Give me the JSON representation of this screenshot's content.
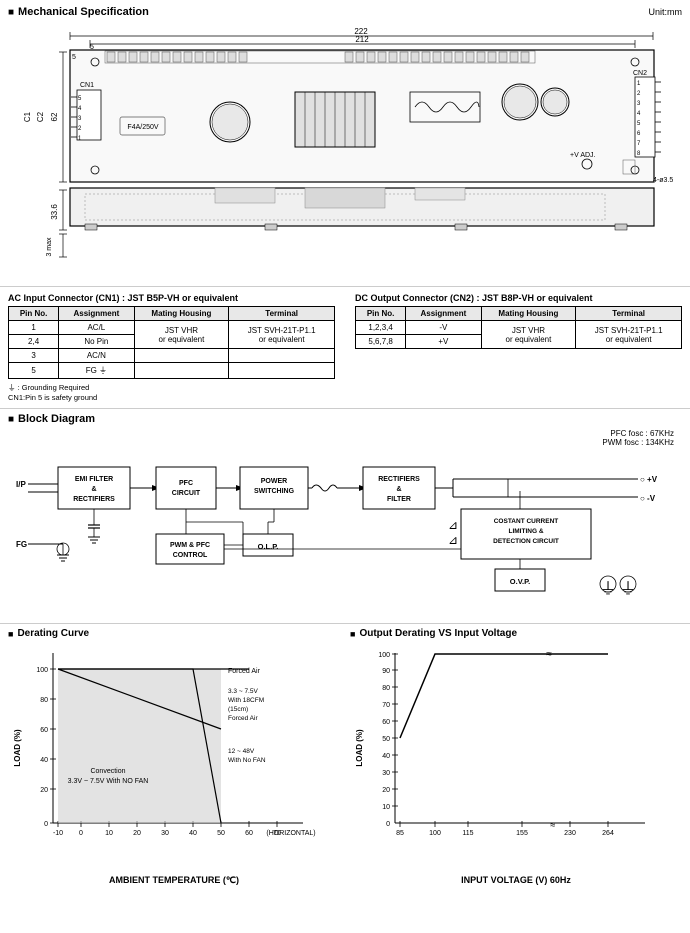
{
  "mech_spec": {
    "section_title": "Mechanical Specification",
    "unit_label": "Unit:mm",
    "dim_222": "222",
    "dim_212": "212",
    "dim_62": "62",
    "dim_33_6": "33.6",
    "dim_5": "5",
    "dim_5s": "5",
    "dim_3max": "3 max",
    "dim_4x3_5": "4-ø3.5",
    "cn1_label": "CN1",
    "cn2_label": "CN2",
    "fuse_label": "F4A/250V",
    "vadj_label": "+V ADJ."
  },
  "ac_connector": {
    "title": "AC Input Connector (CN1) : JST B5P-VH or equivalent",
    "headers": [
      "Pin No.",
      "Assignment",
      "Mating Housing",
      "Terminal"
    ],
    "rows": [
      {
        "pin": "1",
        "assign": "AC/L",
        "housing": "",
        "terminal": ""
      },
      {
        "pin": "2,4",
        "assign": "No Pin",
        "housing": "JST VHR\nor equivalent",
        "terminal": "JST SVH-21T-P1.1\nor equivalent"
      },
      {
        "pin": "3",
        "assign": "AC/N",
        "housing": "",
        "terminal": ""
      },
      {
        "pin": "5",
        "assign": "FG ⏚",
        "housing": "",
        "terminal": ""
      }
    ],
    "note1": "⏚ : Grounding Required",
    "note2": "CN1:Pin 5 is safety ground"
  },
  "dc_connector": {
    "title": "DC Output Connector (CN2) : JST B8P-VH or equivalent",
    "headers": [
      "Pin No.",
      "Assignment",
      "Mating Housing",
      "Terminal"
    ],
    "rows": [
      {
        "pin": "1,2,3,4",
        "assign": "-V",
        "housing": "JST VHR\nor equivalent",
        "terminal": "JST SVH-21T-P1.1\nor equivalent"
      },
      {
        "pin": "5,6,7,8",
        "assign": "+V",
        "housing": "",
        "terminal": ""
      }
    ]
  },
  "block_diagram": {
    "section_title": "Block Diagram",
    "pfc_fosc": "PFC fosc : 67KHz",
    "pwm_fosc": "PWM fosc : 134KHz",
    "ip_label": "I/P",
    "fg_label": "FG",
    "blocks": [
      {
        "id": "emi",
        "label": "EMI FILTER\n& \nRECTIFIERS"
      },
      {
        "id": "pfc",
        "label": "PFC\nCIRCUIT"
      },
      {
        "id": "power_sw",
        "label": "POWER\nSWITCHING"
      },
      {
        "id": "rect_filter",
        "label": "RECTIFIERS\n& \nFILTER"
      },
      {
        "id": "cc_limit",
        "label": "COSTANT CURRENT\nLIMITING &\nDETECTION CIRCUIT"
      },
      {
        "id": "olp",
        "label": "O.L.P."
      },
      {
        "id": "pwm_pfc",
        "label": "PWM & PFC\nCONTROL"
      },
      {
        "id": "ovp",
        "label": "O.V.P."
      }
    ],
    "outputs": [
      "+V",
      "-V"
    ]
  },
  "derating_curve": {
    "section_title": "Derating Curve",
    "x_label": "AMBIENT TEMPERATURE (℃)",
    "y_label": "LOAD (%)",
    "x_ticks": [
      "-10",
      "0",
      "10",
      "20",
      "30",
      "40",
      "50",
      "60",
      "70"
    ],
    "x_note": "(HORIZONTAL)",
    "y_ticks": [
      "0",
      "20",
      "40",
      "60",
      "80",
      "100"
    ],
    "annotations": [
      "Forced Air",
      "3.3 ~ 7.5V\nWith 18CFM\n(15cm)\nForced Air",
      "Convection\n3.3V ~ 7.5V With NO FAN",
      "12 ~ 48V\nWith No FAN"
    ]
  },
  "output_derating": {
    "section_title": "Output Derating VS Input Voltage",
    "x_label": "INPUT VOLTAGE (V) 60Hz",
    "y_label": "LOAD (%)",
    "x_ticks": [
      "85",
      "100",
      "115",
      "155",
      "230",
      "264"
    ],
    "y_ticks": [
      "0",
      "10",
      "20",
      "30",
      "40",
      "50",
      "60",
      "70",
      "80",
      "90",
      "100"
    ]
  }
}
